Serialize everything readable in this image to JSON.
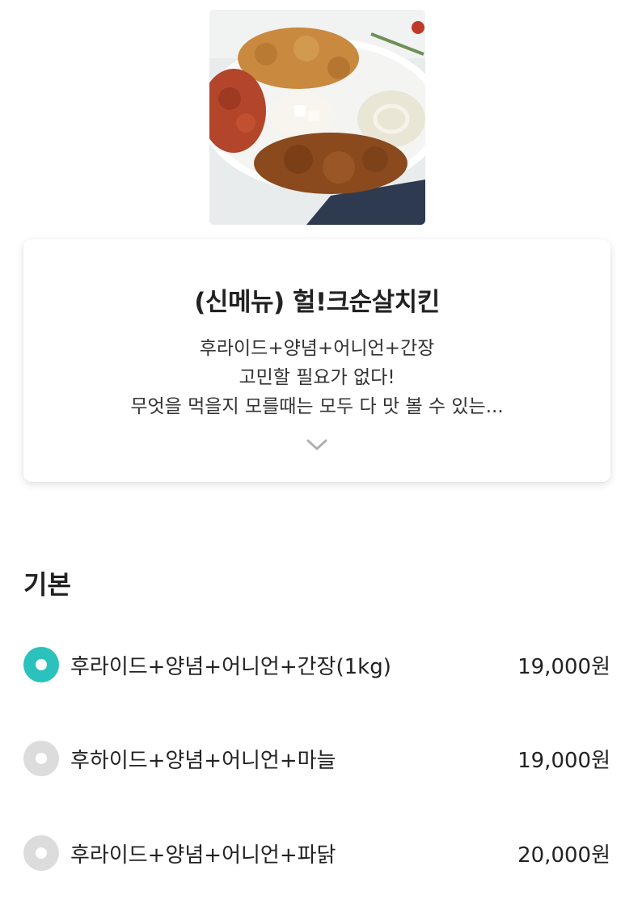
{
  "menu": {
    "title": "(신메뉴) 헐!크순살치킨",
    "description_lines": [
      "후라이드+양념+어니언+간장",
      "고민할 필요가 없다!",
      "무엇을 먹을지 모를때는 모두 다 맛 볼 수 있는..."
    ]
  },
  "options_section": {
    "title": "기본",
    "options": [
      {
        "label": "후라이드+양념+어니언+간장(1kg)",
        "price": "19,000원",
        "selected": true
      },
      {
        "label": "후하이드+양념+어니언+마늘",
        "price": "19,000원",
        "selected": false
      },
      {
        "label": "후라이드+양념+어니언+파닭",
        "price": "20,000원",
        "selected": false
      }
    ]
  },
  "colors": {
    "accent": "#2bc1bc",
    "radio_off": "#dcdcdc"
  },
  "icons": {
    "expand": "chevron-down-icon"
  }
}
